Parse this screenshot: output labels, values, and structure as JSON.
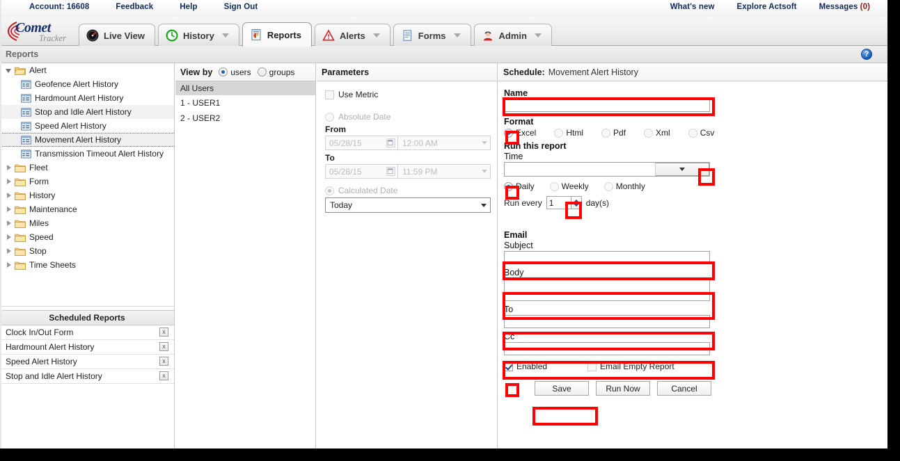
{
  "topbar": {
    "account_label": "Account: 16608",
    "feedback": "Feedback",
    "help": "Help",
    "sign_out": "Sign Out",
    "whats_new": "What's new",
    "explore": "Explore Actsoft",
    "messages": "Messages",
    "messages_count": "(0)"
  },
  "logo": {
    "name": "Comet",
    "sub": "Tracker"
  },
  "tabs": [
    {
      "label": "Live View",
      "icon": "gauge-icon",
      "caret": false,
      "active": false
    },
    {
      "label": "History",
      "icon": "clock-icon",
      "caret": true,
      "active": false
    },
    {
      "label": "Reports",
      "icon": "report-icon",
      "caret": false,
      "active": true
    },
    {
      "label": "Alerts",
      "icon": "warning-icon",
      "caret": true,
      "active": false
    },
    {
      "label": "Forms",
      "icon": "document-icon",
      "caret": true,
      "active": false
    },
    {
      "label": "Admin",
      "icon": "user-icon",
      "caret": true,
      "active": false
    }
  ],
  "subheader": {
    "title": "Reports",
    "help_glyph": "?"
  },
  "tree": {
    "nodes": [
      {
        "label": "Alert",
        "type": "folder",
        "level": 0,
        "open": true,
        "state": ""
      },
      {
        "label": "Geofence Alert History",
        "type": "report",
        "level": 1,
        "state": ""
      },
      {
        "label": "Hardmount Alert History",
        "type": "report",
        "level": 1,
        "state": ""
      },
      {
        "label": "Stop and Idle Alert History",
        "type": "report",
        "level": 1,
        "state": "hover"
      },
      {
        "label": "Speed Alert History",
        "type": "report",
        "level": 1,
        "state": ""
      },
      {
        "label": "Movement Alert History",
        "type": "report",
        "level": 1,
        "state": "selected"
      },
      {
        "label": "Transmission Timeout Alert History",
        "type": "report",
        "level": 1,
        "state": ""
      },
      {
        "label": "Fleet",
        "type": "folder",
        "level": 0,
        "open": false,
        "state": ""
      },
      {
        "label": "Form",
        "type": "folder",
        "level": 0,
        "open": false,
        "state": ""
      },
      {
        "label": "History",
        "type": "folder",
        "level": 0,
        "open": false,
        "state": ""
      },
      {
        "label": "Maintenance",
        "type": "folder",
        "level": 0,
        "open": false,
        "state": ""
      },
      {
        "label": "Miles",
        "type": "folder",
        "level": 0,
        "open": false,
        "state": ""
      },
      {
        "label": "Speed",
        "type": "folder",
        "level": 0,
        "open": false,
        "state": ""
      },
      {
        "label": "Stop",
        "type": "folder",
        "level": 0,
        "open": false,
        "state": ""
      },
      {
        "label": "Time Sheets",
        "type": "folder",
        "level": 0,
        "open": false,
        "state": ""
      }
    ]
  },
  "scheduled_reports": {
    "header": "Scheduled Reports",
    "delete_glyph": "x",
    "items": [
      {
        "label": "Clock In/Out Form"
      },
      {
        "label": "Hardmount Alert History"
      },
      {
        "label": "Speed Alert History"
      },
      {
        "label": "Stop and Idle Alert History"
      }
    ]
  },
  "viewby": {
    "title": "View by",
    "option_users": "users",
    "option_groups": "groups",
    "selected": "users",
    "all_users": "All Users",
    "users": [
      {
        "label": "1 - USER1"
      },
      {
        "label": "2 - USER2"
      }
    ]
  },
  "parameters": {
    "title": "Parameters",
    "use_metric": "Use Metric",
    "use_metric_checked": false,
    "absolute_date": "Absolute Date",
    "absolute_selected": false,
    "from_label": "From",
    "from_date": "05/28/15",
    "from_time": "12:00 AM",
    "to_label": "To",
    "to_date": "05/28/15",
    "to_time": "11:59 PM",
    "calculated_date": "Calculated Date",
    "calculated_selected": true,
    "calculated_value": "Today"
  },
  "schedule": {
    "title": "Schedule:",
    "report_name": "Movement Alert History",
    "name_label": "Name",
    "name_value": "",
    "format_label": "Format",
    "formats": [
      {
        "label": "Excel",
        "selected": true
      },
      {
        "label": "Html",
        "selected": false
      },
      {
        "label": "Pdf",
        "selected": false
      },
      {
        "label": "Xml",
        "selected": false
      },
      {
        "label": "Csv",
        "selected": false
      }
    ],
    "run_this_report": "Run this report",
    "time_label": "Time",
    "time_value": "",
    "frequencies": [
      {
        "label": "Daily",
        "selected": true
      },
      {
        "label": "Weekly",
        "selected": false
      },
      {
        "label": "Monthly",
        "selected": false
      }
    ],
    "run_every_label": "Run every",
    "run_every_value": "1",
    "run_every_unit": "day(s)",
    "email_label": "Email",
    "subject_label": "Subject",
    "subject_value": "",
    "body_label": "Body",
    "body_value": "",
    "to_label": "To",
    "to_value": "",
    "cc_label": "Cc",
    "cc_value": "",
    "enabled_label": "Enabled",
    "enabled_checked": true,
    "email_empty_label": "Email Empty Report",
    "email_empty_checked": false,
    "save_label": "Save",
    "run_now_label": "Run Now",
    "cancel_label": "Cancel"
  },
  "colors": {
    "highlight": "#fe0000",
    "accent_blue": "#1964b8",
    "link_navy": "#0e2a5a",
    "count_red": "#8b1b1b"
  }
}
